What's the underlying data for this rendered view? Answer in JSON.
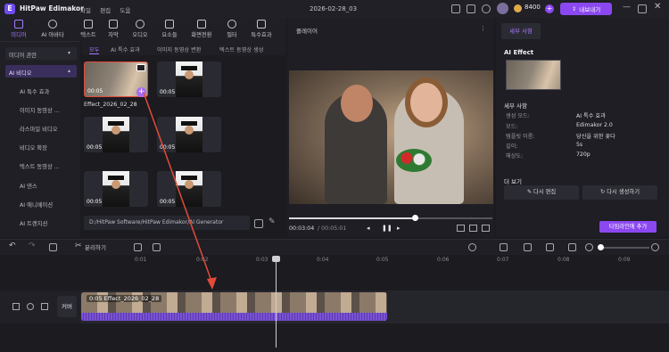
{
  "titlebar": {
    "app_name": "HitPaw Edimakor",
    "logo_text": "E",
    "menu": [
      "파일",
      "편집",
      "도움"
    ],
    "project_name": "2026-02-28_03",
    "credits": "8400",
    "upgrade_label": "내보내기"
  },
  "toolbar": {
    "items": [
      "미디어",
      "AI 아바타",
      "텍스트",
      "자막",
      "오디오",
      "요소들",
      "화면전환",
      "필터",
      "특수효과"
    ]
  },
  "leftnav": {
    "dropdowns": [
      "미디어 관련",
      "AI 비디오"
    ],
    "items": [
      "AI 특수 효과",
      "이미지 동영상 ...",
      "라스마일 비디오",
      "비디오 확장",
      "텍스트 동영상 ...",
      "AI 댄스",
      "AI 애니메이션",
      "AI 트랜지션"
    ]
  },
  "media_tabs": [
    "모두",
    "AI 특수 효과",
    "이미지 동영상 변환",
    "텍스트 동영상 생성"
  ],
  "thumbnails": {
    "duration": "00:05",
    "first_name": "Effect_2026_02_28"
  },
  "path": "D:/HitPaw Software/HitPaw Edimakor/AI Generator",
  "player": {
    "header": "플레이어",
    "progress": 0.62,
    "current_time": "00:03:04",
    "total_time": "/ 00:05:01"
  },
  "rpanel": {
    "tab": "세부 사항",
    "effect_label": "AI Effect",
    "detail_title": "세부 사항",
    "details": [
      {
        "k": "생성 모드:",
        "v": "AI 특수 효과"
      },
      {
        "k": "모드:",
        "v": "Edimakor 2.0"
      },
      {
        "k": "템플릿 이름:",
        "v": "당신을 위한 꽃다"
      },
      {
        "k": "길이:",
        "v": "5s"
      },
      {
        "k": "해상도:",
        "v": "720p"
      }
    ],
    "more_title": "더 보기",
    "edit_again": "다시 편집",
    "regenerate": "다시 생성하기",
    "add_to_timeline": "타임라인에 추가"
  },
  "timeline": {
    "split_label": "분리하기",
    "ticks": [
      "0:01",
      "0:02",
      "0:03",
      "0:04",
      "0:05",
      "0:06",
      "0:07",
      "0:08",
      "0:09"
    ],
    "cover_label": "커버",
    "clip_label": "0:05 Effect_2026_02_28"
  },
  "colors": {
    "accent": "#8b48f0",
    "highlight_red": "#e34a3a"
  }
}
